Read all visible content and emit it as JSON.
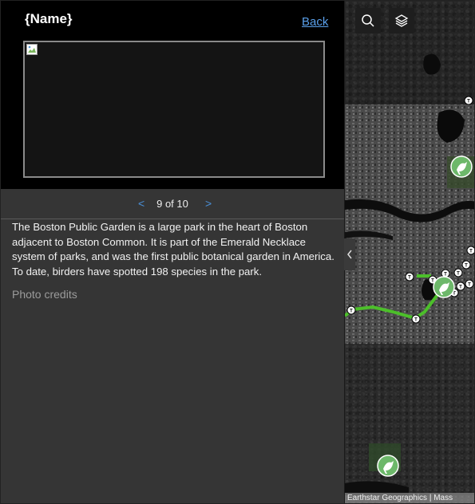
{
  "panel": {
    "title": "{Name}",
    "back_label": "Back",
    "pager": {
      "prev_label": "<",
      "count": "9 of 10",
      "next_label": ">"
    },
    "description": "The Boston Public Garden is a large park in the heart of Boston adjacent to Boston Common. It is part of the Emerald Necklace system of parks, and was the first public botanical garden in America. To date, birders have spotted 198 species in the park.",
    "photo_credits_label": "Photo credits"
  },
  "map": {
    "attribution": "Earthstar Geographics | Mass",
    "search_icon": "search-icon",
    "layers_icon": "layers-icon",
    "collapse_icon": "chevron-left-icon",
    "route_color": "#4cbf2a",
    "marker_color": "#6db86a"
  }
}
